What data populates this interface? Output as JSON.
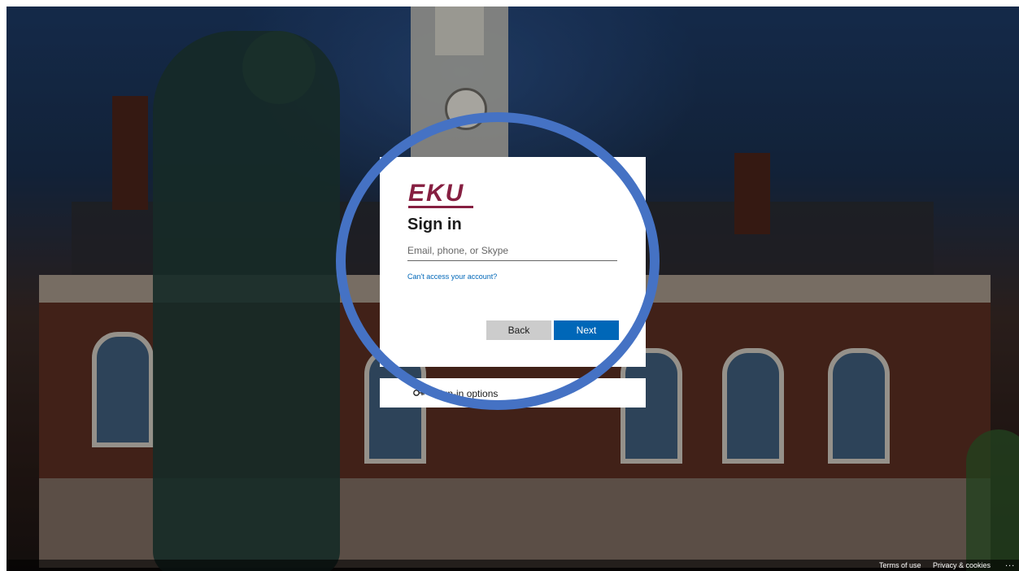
{
  "background": {
    "description_icon": "campus-building-with-statue-photo"
  },
  "login_card": {
    "logo_text": "EKU",
    "title": "Sign in",
    "email_placeholder": "Email, phone, or Skype",
    "email_value": "",
    "help_link": "Can't access your account?",
    "back_label": "Back",
    "next_label": "Next"
  },
  "signin_options": {
    "label": "Sign-in options",
    "icon": "key-icon"
  },
  "highlight": {
    "color": "#4572c4"
  },
  "footer": {
    "terms": "Terms of use",
    "privacy": "Privacy & cookies",
    "more": "..."
  },
  "colors": {
    "brand": "#861f41",
    "accent": "#0067b8"
  }
}
